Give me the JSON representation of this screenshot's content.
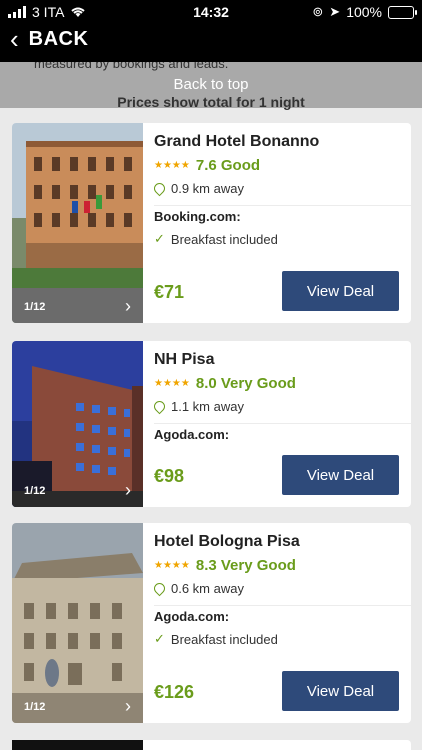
{
  "status": {
    "carrier": "3 ITA",
    "time": "14:32",
    "battery": "100%"
  },
  "nav": {
    "back_label": "BACK"
  },
  "overlay": {
    "behind_text": "measured by bookings and leads.",
    "back_to_top": "Back to top",
    "price_note": "Prices show total for 1 night"
  },
  "hotels": [
    {
      "name": "Grand Hotel Bonanno",
      "stars": "★★★★",
      "rating": "7.6 Good",
      "distance": "0.9 km away",
      "provider": "Booking.com:",
      "amenity": "Breakfast included",
      "price": "€71",
      "photo_counter": "1/12",
      "cta": "View Deal"
    },
    {
      "name": "NH Pisa",
      "stars": "★★★★",
      "rating": "8.0 Very Good",
      "distance": "1.1 km away",
      "provider": "Agoda.com:",
      "amenity": "",
      "price": "€98",
      "photo_counter": "1/12",
      "cta": "View Deal"
    },
    {
      "name": "Hotel Bologna Pisa",
      "stars": "★★★★",
      "rating": "8.3 Very Good",
      "distance": "0.6 km away",
      "provider": "Agoda.com:",
      "amenity": "Breakfast included",
      "price": "€126",
      "photo_counter": "1/12",
      "cta": "View Deal"
    }
  ],
  "colors": {
    "accent_green": "#6a9c1b",
    "deal_blue": "#2e4a7a",
    "star_gold": "#f0a500"
  }
}
